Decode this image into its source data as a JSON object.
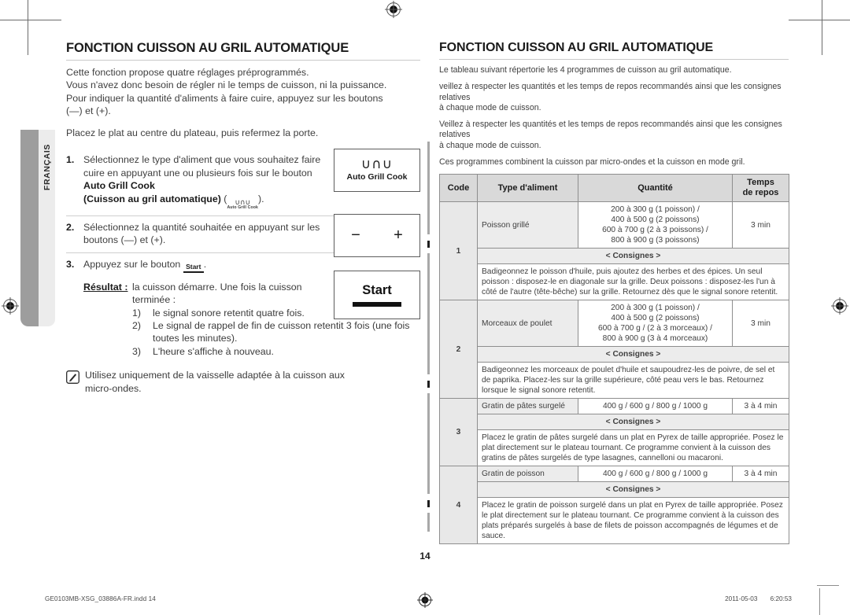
{
  "side_tab": {
    "label": "FRANÇAIS"
  },
  "left": {
    "title": "FONCTION CUISSON AU GRIL AUTOMATIQUE",
    "intro_lines": [
      "Cette fonction propose quatre réglages préprogrammés.",
      "Vous n'avez donc besoin de régler ni le temps de cuisson, ni la puissance.",
      "Pour indiquer la quantité d'aliments à faire cuire, appuyez sur les boutons",
      "(—) et (+)."
    ],
    "place_line": "Placez le plat au centre du plateau, puis refermez la porte.",
    "steps": [
      {
        "num": "1.",
        "text_a": "Sélectionnez le type d'aliment que vous souhaitez faire cuire en appuyant une ou plusieurs fois sur le bouton ",
        "bold_a": "Auto Grill Cook",
        "bold_b": "(Cuisson au gril automatique)",
        "text_b": " (",
        "text_c": ")."
      },
      {
        "num": "2.",
        "text_a": "Sélectionnez la quantité souhaitée en appuyant sur les boutons (—) et (+)."
      },
      {
        "num": "3.",
        "text_a": "Appuyez sur le bouton ",
        "text_c": "."
      }
    ],
    "result": {
      "label": "Résultat :",
      "text": "la cuisson démarre. Une fois la cuisson terminée :",
      "items": [
        {
          "marker": "1)",
          "text": "le signal sonore retentit quatre fois."
        },
        {
          "marker": "2)",
          "text": "Le signal de rappel de fin de cuisson retentit 3 fois (une fois toutes les minutes)."
        },
        {
          "marker": "3)",
          "text": "L'heure s'affiche à nouveau."
        }
      ]
    },
    "note": "Utilisez uniquement de la vaisselle adaptée à la cuisson aux micro-ondes.",
    "panels": {
      "auto_grill_glyph": "∪∩∪",
      "auto_grill_label": "Auto Grill Cook",
      "minus": "−",
      "plus": "+",
      "start_label": "Start"
    }
  },
  "right": {
    "title": "FONCTION CUISSON AU GRIL AUTOMATIQUE",
    "intro_lines": [
      "Le tableau suivant répertorie les 4 programmes de cuisson au gril automatique.",
      "veillez à respecter les quantités et les temps de repos recommandés ainsi que les consignes relatives",
      "à chaque mode de cuisson.",
      "Veillez à respecter les quantités et les temps de repos recommandés ainsi que les consignes relatives",
      "à chaque mode de cuisson.",
      "Ces programmes combinent la cuisson par micro-ondes et la cuisson en mode gril."
    ],
    "table": {
      "headers": [
        "Code",
        "Type d'aliment",
        "Quantité",
        "Temps de repos"
      ],
      "header_repos_line1": "Temps",
      "header_repos_line2": "de repos",
      "consignes_label": "< Consignes >",
      "rows": [
        {
          "code": "1",
          "type": "Poisson grillé",
          "quantity_lines": [
            "200 à 300 g (1 poisson) /",
            "400 à 500 g (2 poissons)",
            "600 à 700 g (2 à 3 poissons) /",
            "800 à 900 g (3 poissons)"
          ],
          "repos": "3 min",
          "consignes": "Badigeonnez le poisson d'huile, puis ajoutez des herbes et des épices. Un seul poisson : disposez-le en diagonale sur la grille. Deux poissons : disposez-les l'un à côté de l'autre (tête-bêche) sur la grille. Retournez dès que le signal sonore retentit."
        },
        {
          "code": "2",
          "type": "Morceaux de poulet",
          "quantity_lines": [
            "200 à 300 g (1 poisson) /",
            "400 à 500 g (2 poissons)",
            "600 à 700 g / (2 à 3 morceaux) /",
            "800 à 900 g (3 à 4 morceaux)"
          ],
          "repos": "3 min",
          "consignes": "Badigeonnez les morceaux de poulet d'huile et saupoudrez-les de poivre, de sel et de paprika. Placez-les sur la grille supérieure, côté peau vers le bas. Retournez lorsque le signal sonore retentit."
        },
        {
          "code": "3",
          "type": "Gratin de pâtes surgelé",
          "quantity_lines": [
            "400 g / 600 g / 800 g / 1000 g"
          ],
          "repos": "3 à 4 min",
          "consignes": "Placez le gratin de pâtes surgelé dans un plat en Pyrex de taille appropriée. Posez le plat directement sur le plateau tournant. Ce programme convient à la cuisson des gratins de pâtes surgelés de type lasagnes, cannelloni ou macaroni."
        },
        {
          "code": "4",
          "type": "Gratin de poisson",
          "quantity_lines": [
            "400 g / 600 g / 800 g / 1000 g"
          ],
          "repos": "3 à 4 min",
          "consignes": "Placez le gratin de poisson surgelé dans un plat en Pyrex de taille appropriée. Posez le plat directement sur le plateau tournant. Ce programme convient à la cuisson des plats préparés surgelés à base de filets de poisson accompagnés de légumes et de sauce."
        }
      ]
    }
  },
  "footer": {
    "page_number": "14",
    "file_name": "GE0103MB-XSG_03886A-FR.indd   14",
    "date": "2011-05-03",
    "time": "6:20:53"
  }
}
